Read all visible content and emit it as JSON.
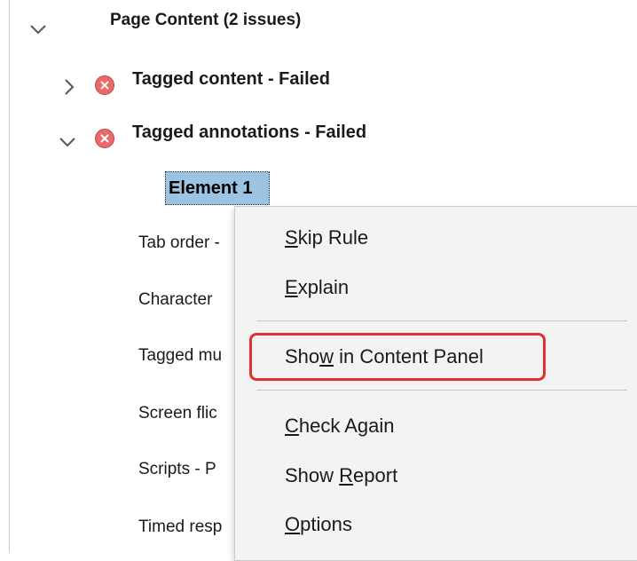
{
  "tree": {
    "section": {
      "label": "Page Content (2 issues)"
    },
    "rules": [
      {
        "label": "Tagged content - Failed",
        "status": "failed",
        "expanded": false
      },
      {
        "label": "Tagged annotations - Failed",
        "status": "failed",
        "expanded": true
      }
    ],
    "selected_element": {
      "label": "Element 1"
    },
    "children": [
      "Tab order -",
      "Character",
      "Tagged mu",
      "Screen flic",
      "Scripts - P",
      "Timed resp"
    ]
  },
  "context_menu": {
    "items": [
      {
        "pre": "",
        "key": "S",
        "post": "kip Rule"
      },
      {
        "pre": "",
        "key": "E",
        "post": "xplain"
      },
      {
        "pre": "Sho",
        "key": "w",
        "post": " in Content Panel",
        "highlighted": true
      },
      {
        "pre": "",
        "key": "C",
        "post": "heck Again"
      },
      {
        "pre": "Show ",
        "key": "R",
        "post": "eport"
      },
      {
        "pre": "",
        "key": "O",
        "post": "ptions"
      }
    ]
  },
  "colors": {
    "selection": "#9cc3e1",
    "error_icon": "#e86a6a",
    "highlight_border": "#e03131",
    "menu_background": "#f3f3f3"
  },
  "icons": [
    "chevron-down-icon",
    "chevron-right-icon",
    "error-icon"
  ]
}
